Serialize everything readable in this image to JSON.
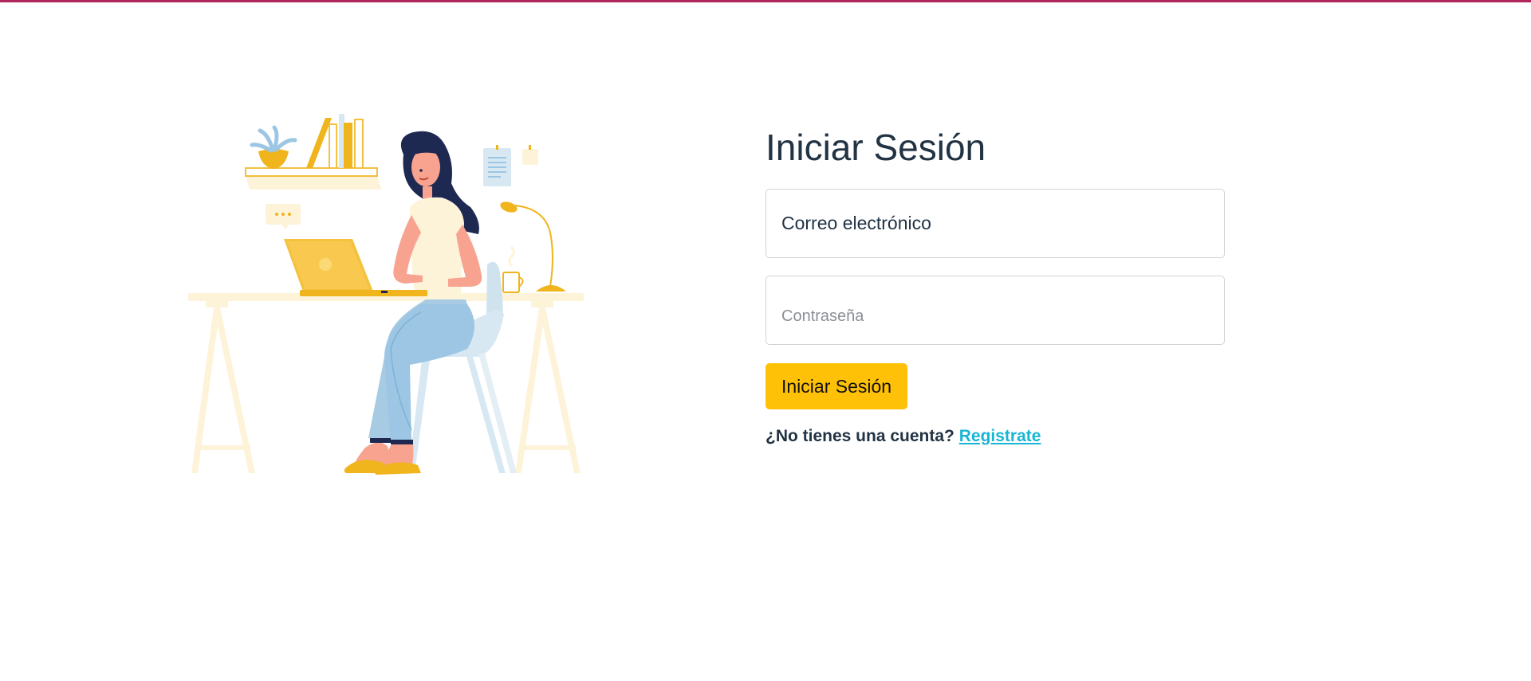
{
  "theme": {
    "top_accent_color": "#b0275e",
    "button_color": "#ffc107",
    "link_color": "#19b5d6"
  },
  "login": {
    "title": "Iniciar Sesión",
    "email_field": {
      "value": "",
      "placeholder": "Correo electrónico"
    },
    "password_field": {
      "value": "",
      "placeholder": "Contraseña"
    },
    "submit_label": "Iniciar Sesión",
    "signup_prompt": "¿No tienes una cuenta?",
    "signup_link": "Registrate"
  },
  "illustration": {
    "icon": "woman-working-at-desk-illustration"
  }
}
